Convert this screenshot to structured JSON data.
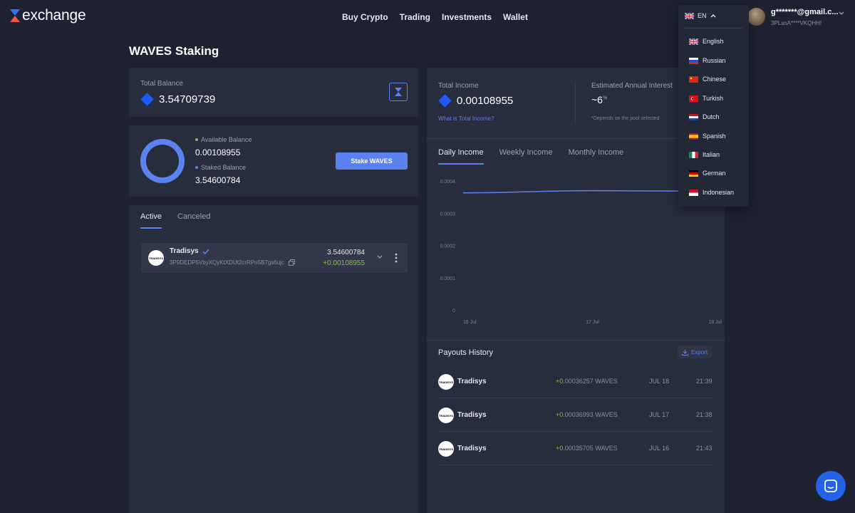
{
  "header": {
    "logo_text": "exchange",
    "nav": [
      "Buy Crypto",
      "Trading",
      "Investments",
      "Wallet"
    ],
    "lang_code": "EN",
    "account_email": "g*******@gmail.c...",
    "account_address": "3PLsnA****VKQHH!"
  },
  "page": {
    "title": "WAVES Staking"
  },
  "balance": {
    "total_label": "Total Balance",
    "total_value": "3.54709739",
    "available_label": "Available Balance",
    "available_value": "0.00108955",
    "staked_label": "Staked Balance",
    "staked_value": "3.54600784",
    "stake_button": "Stake WAVES",
    "colors": {
      "available": "#7ac24a",
      "staked": "#5a82f0"
    }
  },
  "stakes": {
    "tabs": [
      "Active",
      "Canceled"
    ],
    "active_tab": "Active",
    "items": [
      {
        "provider": "Tradisys",
        "logo_text": "TRADISYS",
        "address": "3P9DEDP5VbyXQyKtXDUt2crRPn5B7gs6ujc",
        "staked": "3.54600784",
        "income": "+0.00108955"
      }
    ]
  },
  "income": {
    "total_label": "Total Income",
    "total_value": "0.00108955",
    "what_link": "What is Total Income?",
    "annual_label": "Estimated Annual Interest",
    "annual_value": "~6",
    "annual_unit": "%",
    "annual_note": "*Depends on the pool selected",
    "tabs": [
      "Daily Income",
      "Weekly Income",
      "Monthly Income"
    ],
    "active_tab": "Daily Income"
  },
  "chart_data": {
    "type": "line",
    "x": [
      "16 Jul",
      "17 Jul",
      "18 Jul"
    ],
    "y_ticks": [
      "0.0004",
      "0.0003",
      "0.0002",
      "0.0001",
      "0"
    ],
    "ylim": [
      0,
      0.0004
    ],
    "series": [
      {
        "values": [
          0.000363,
          0.00037,
          0.000368
        ]
      }
    ],
    "line_color": "#5a82f0",
    "grid": false
  },
  "payouts": {
    "title": "Payouts History",
    "export_label": "Export",
    "rows": [
      {
        "provider": "Tradisys",
        "logo_text": "TRADISYS",
        "plus": "+0.",
        "amount": "00036257 WAVES",
        "date": "JUL 18",
        "time": "21:39"
      },
      {
        "provider": "Tradisys",
        "logo_text": "TRADISYS",
        "plus": "+0.",
        "amount": "00036993 WAVES",
        "date": "JUL 17",
        "time": "21:38"
      },
      {
        "provider": "Tradisys",
        "logo_text": "TRADISYS",
        "plus": "+0.",
        "amount": "00035705 WAVES",
        "date": "JUL 16",
        "time": "21:43"
      }
    ]
  },
  "languages": {
    "current": "EN",
    "items": [
      {
        "label": "English",
        "flag": "uk-flag-icon"
      },
      {
        "label": "Russian",
        "flag": "russia-flag-icon"
      },
      {
        "label": "Chinese",
        "flag": "china-flag-icon"
      },
      {
        "label": "Turkish",
        "flag": "turkey-flag-icon"
      },
      {
        "label": "Dutch",
        "flag": "netherlands-flag-icon"
      },
      {
        "label": "Spanish",
        "flag": "spain-flag-icon"
      },
      {
        "label": "Italian",
        "flag": "italy-flag-icon"
      },
      {
        "label": "German",
        "flag": "germany-flag-icon"
      },
      {
        "label": "Indonesian",
        "flag": "indonesia-flag-icon"
      }
    ]
  }
}
